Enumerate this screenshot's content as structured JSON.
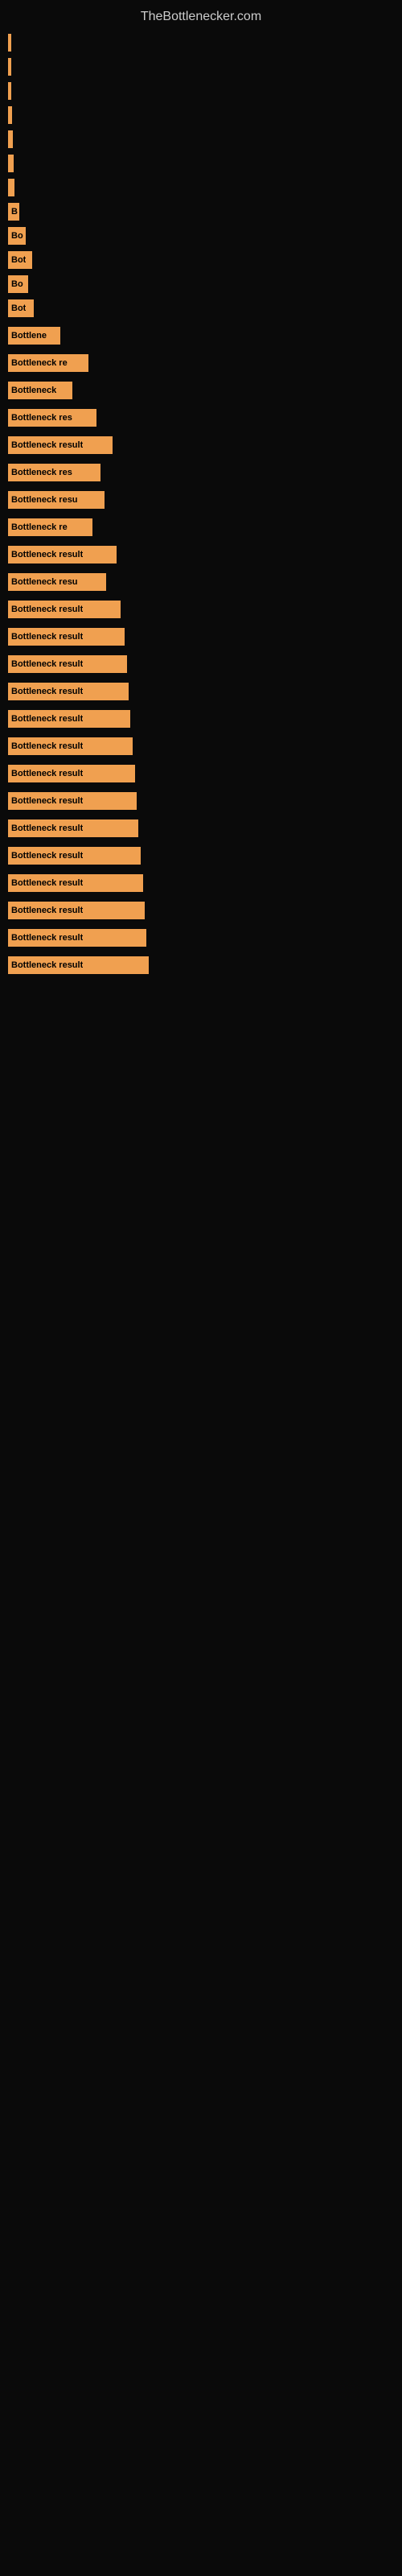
{
  "site": {
    "title": "TheBottlenecker.com"
  },
  "bars": [
    {
      "label": "",
      "width": 2,
      "text": ""
    },
    {
      "label": "",
      "width": 3,
      "text": ""
    },
    {
      "label": "",
      "width": 4,
      "text": ""
    },
    {
      "label": "",
      "width": 5,
      "text": ""
    },
    {
      "label": "",
      "width": 6,
      "text": ""
    },
    {
      "label": "",
      "width": 7,
      "text": ""
    },
    {
      "label": "",
      "width": 8,
      "text": ""
    },
    {
      "label": "B",
      "width": 14,
      "text": "B"
    },
    {
      "label": "Bo",
      "width": 22,
      "text": "Bo"
    },
    {
      "label": "Bot",
      "width": 30,
      "text": "Bot"
    },
    {
      "label": "Bo",
      "width": 25,
      "text": "Bo"
    },
    {
      "label": "Bot",
      "width": 32,
      "text": "Bot"
    },
    {
      "label": "Bottlene",
      "width": 65,
      "text": "Bottlene"
    },
    {
      "label": "Bottleneck re",
      "width": 100,
      "text": "Bottleneck re"
    },
    {
      "label": "Bottleneck",
      "width": 80,
      "text": "Bottleneck"
    },
    {
      "label": "Bottleneck res",
      "width": 110,
      "text": "Bottleneck res"
    },
    {
      "label": "Bottleneck result",
      "width": 130,
      "text": "Bottleneck result"
    },
    {
      "label": "Bottleneck res",
      "width": 115,
      "text": "Bottleneck res"
    },
    {
      "label": "Bottleneck resu",
      "width": 120,
      "text": "Bottleneck resu"
    },
    {
      "label": "Bottleneck re",
      "width": 105,
      "text": "Bottleneck re"
    },
    {
      "label": "Bottleneck result",
      "width": 135,
      "text": "Bottleneck result"
    },
    {
      "label": "Bottleneck resu",
      "width": 122,
      "text": "Bottleneck resu"
    },
    {
      "label": "Bottleneck result",
      "width": 140,
      "text": "Bottleneck result"
    },
    {
      "label": "Bottleneck result",
      "width": 145,
      "text": "Bottleneck result"
    },
    {
      "label": "Bottleneck result",
      "width": 148,
      "text": "Bottleneck result"
    },
    {
      "label": "Bottleneck result",
      "width": 150,
      "text": "Bottleneck result"
    },
    {
      "label": "Bottleneck result",
      "width": 152,
      "text": "Bottleneck result"
    },
    {
      "label": "Bottleneck result",
      "width": 155,
      "text": "Bottleneck result"
    },
    {
      "label": "Bottleneck result",
      "width": 158,
      "text": "Bottleneck result"
    },
    {
      "label": "Bottleneck result",
      "width": 160,
      "text": "Bottleneck result"
    },
    {
      "label": "Bottleneck result",
      "width": 162,
      "text": "Bottleneck result"
    },
    {
      "label": "Bottleneck result",
      "width": 165,
      "text": "Bottleneck result"
    },
    {
      "label": "Bottleneck result",
      "width": 168,
      "text": "Bottleneck result"
    },
    {
      "label": "Bottleneck result",
      "width": 170,
      "text": "Bottleneck result"
    },
    {
      "label": "Bottleneck result",
      "width": 172,
      "text": "Bottleneck result"
    },
    {
      "label": "Bottleneck result",
      "width": 175,
      "text": "Bottleneck result"
    }
  ]
}
